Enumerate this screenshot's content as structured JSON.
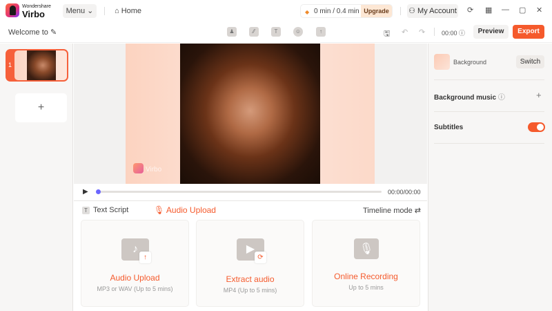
{
  "app": {
    "brand_small": "Wondershare",
    "brand": "Virbo",
    "menu": "Menu ⌄",
    "home": "Home",
    "usage": "0 min / 0.4 min",
    "upgrade": "Upgrade",
    "account": "My Account"
  },
  "project": {
    "title": "Welcome to",
    "time": "00:00",
    "preview": "Preview",
    "export": "Export"
  },
  "toolbar": {
    "icons": [
      "avatar-icon",
      "background-icon",
      "text-icon",
      "sticker-icon",
      "upload-icon"
    ]
  },
  "slides": [
    {
      "number": "1"
    }
  ],
  "add_slide": "+",
  "watermark": "Virbo",
  "player": {
    "time": "00:00/00:00",
    "progress": 0
  },
  "script_tabs": {
    "text": "Text Script",
    "text_icon": "T",
    "audio": "Audio Upload",
    "timeline": "Timeline mode ⇄"
  },
  "cards": [
    {
      "title": "Audio Upload",
      "sub": "MP3 or WAV (Up to 5 mins)"
    },
    {
      "title": "Extract audio",
      "sub": "MP4 (Up to 5 mins)"
    },
    {
      "title": "Online Recording",
      "sub": "Up to 5 mins"
    }
  ],
  "right": {
    "background": "Background",
    "switch": "Switch",
    "music": "Background music",
    "subtitles": "Subtitles",
    "subtitles_on": true
  },
  "colors": {
    "accent": "#f55a2c",
    "progress_knob": "#6b66ff"
  }
}
